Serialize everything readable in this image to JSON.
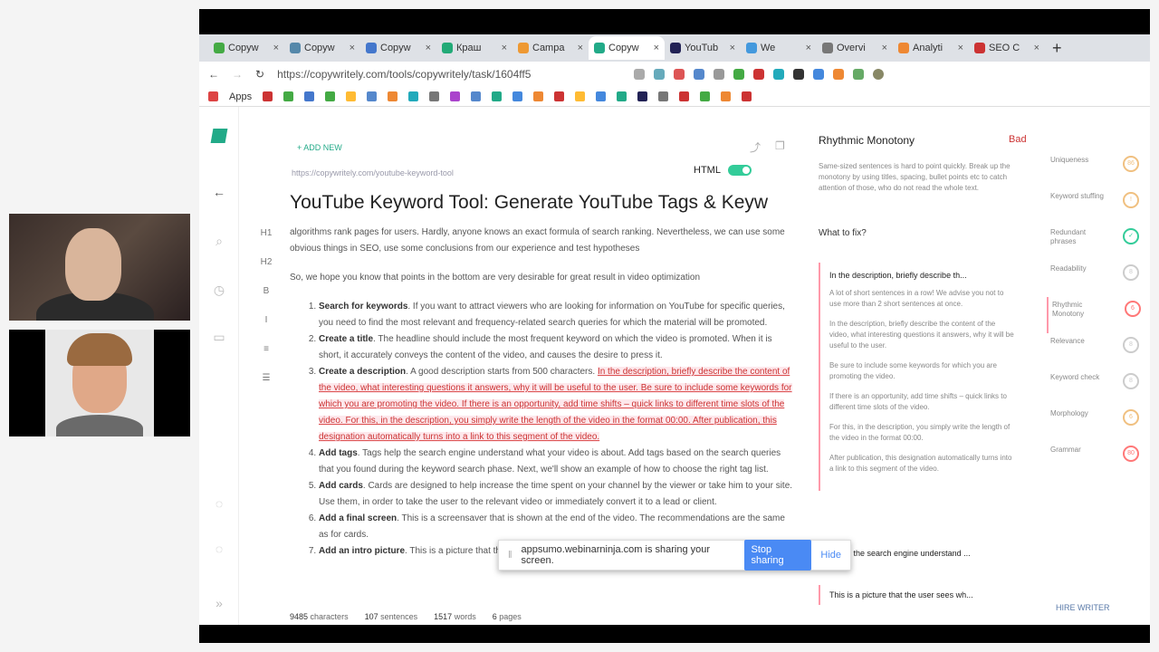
{
  "browser": {
    "tabs": [
      {
        "label": "Copyw",
        "color": "#4a4"
      },
      {
        "label": "Copyw",
        "color": "#58a"
      },
      {
        "label": "Copyw",
        "color": "#47c"
      },
      {
        "label": "Краш",
        "color": "#2a7"
      },
      {
        "label": "Campa",
        "color": "#e93"
      },
      {
        "label": "Copyw",
        "color": "#2a8"
      },
      {
        "label": "YouTub",
        "color": "#225"
      },
      {
        "label": "We",
        "color": "#49d"
      },
      {
        "label": "Overvi",
        "color": "#777"
      },
      {
        "label": "Analyti",
        "color": "#e83"
      },
      {
        "label": "SEO C",
        "color": "#c33"
      }
    ],
    "new_tab": "+",
    "url": "https://copywritely.com/tools/copywritely/task/1604ff5",
    "apps_label": "Apps"
  },
  "editor": {
    "tagline": "+ ADD NEW",
    "source_url": "https://copywritely.com/youtube-keyword-tool",
    "html_label": "HTML",
    "title": "YouTube Keyword Tool: Generate YouTube Tags & Keyw",
    "para1": "algorithms rank pages for users. Hardly, anyone knows an exact formula of search ranking. Nevertheless, we can use some obvious things in SEO, use some conclusions from our experience and test hypotheses",
    "para2": "So, we hope you know that points in the bottom are very desirable for great result in video optimization",
    "list": [
      {
        "head": "Search for keywords",
        "text": ". If you want to attract viewers who are looking for information on YouTube for specific queries, you need to find the most relevant and frequency-related search queries for which the material will be promoted."
      },
      {
        "head": "Create a title",
        "text": ". The headline should include the most frequent keyword on which the video is promoted. When it is short, it accurately conveys the content of the video, and causes the desire to press it."
      },
      {
        "head": "Create a description",
        "text": ". A good description starts from 500 characters. ",
        "highlight": "In the description, briefly describe the content of the video, what interesting questions it answers, why it will be useful to the user. Be sure to include some keywords for which you are promoting the video. If there is an opportunity, add time shifts – quick links to different time slots of the video. For this, in the description, you simply write the length of the video in the format 00:00. After publication, this designation automatically turns into a link to this segment of the video."
      },
      {
        "head": "Add tags",
        "text": ". Tags help the search engine understand what your video is about. Add tags based on the search queries that you found during the keyword search phase. Next, we'll show an example of how to choose the right tag list."
      },
      {
        "head": "Add cards",
        "text": ". Cards are designed to help increase the time spent on your channel by the viewer or take him to your site. Use them, in order to take the user to the relevant video or immediately convert it to a lead or client."
      },
      {
        "head": "Add a final screen",
        "text": ". This is a screensaver that is shown at the end of the video. The recommendations are the same as for cards."
      },
      {
        "head": "Add an intro picture",
        "text": ". This is a picture that the user sees while watching the video lists in his tape, or sees the"
      }
    ],
    "stats": [
      {
        "value": "9485",
        "label": "characters"
      },
      {
        "value": "107",
        "label": "sentences"
      },
      {
        "value": "1517",
        "label": "words"
      },
      {
        "value": "6",
        "label": "pages"
      }
    ],
    "toolbar": [
      "H1",
      "H2",
      "B",
      "I",
      "≡",
      "☰"
    ]
  },
  "panel": {
    "title": "Rhythmic Monotony",
    "status": "Bad",
    "description": "Same-sized sentences is hard to point quickly. Break up the monotony by using titles, spacing, bullet points etc to catch attention of those, who do not read the whole text.",
    "what_to_fix": "What to fix?",
    "issue_title": "In the description, briefly describe th...",
    "issue_points": [
      "A lot of short sentences in a row! We advise you not to use more than 2 short sentences at once.",
      "In the description, briefly describe the content of the video, what interesting questions it answers, why it will be useful to the user.",
      "Be sure to include some keywords for which you are promoting the video.",
      "If there is an opportunity, add time shifts – quick links to different time slots of the video.",
      "For this, in the description, you simply write the length of the video in the format 00:00.",
      "After publication, this designation automatically turns into a link to this segment of the video."
    ],
    "issue2": "s help the search engine understand ...",
    "issue3": "This is a picture that the user sees wh..."
  },
  "metrics": [
    {
      "label": "Uniqueness",
      "value": "86",
      "color": "#f0c080"
    },
    {
      "label": "Keyword stuffing",
      "value": "!",
      "color": "#f0c080"
    },
    {
      "label": "Redundant phrases",
      "value": "✓",
      "color": "#3c9"
    },
    {
      "label": "Readability",
      "value": "8",
      "color": "#ccc"
    },
    {
      "label": "Rhythmic Monotony",
      "value": "6",
      "color": "#f77"
    },
    {
      "label": "Relevance",
      "value": "8",
      "color": "#ccc"
    },
    {
      "label": "Keyword check",
      "value": "8",
      "color": "#ccc"
    },
    {
      "label": "Morphology",
      "value": "6",
      "color": "#f0c080"
    },
    {
      "label": "Grammar",
      "value": "80",
      "color": "#f77"
    }
  ],
  "hire_writer": "HIRE WRITER",
  "share_bar": {
    "text": "appsumo.webinarninja.com is sharing your screen.",
    "stop": "Stop sharing",
    "hide": "Hide"
  }
}
